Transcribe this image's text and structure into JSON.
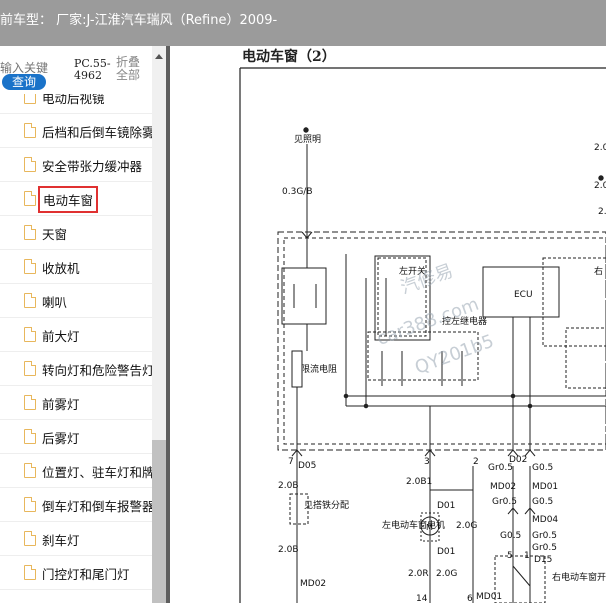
{
  "window": {
    "title": "前车型：   厂家:J-江淮汽车瑞风（Refine）2009-"
  },
  "sidebar": {
    "search_placeholder": "输入关键",
    "search_button": "查询",
    "pc_code": "PC.55-4962",
    "collapse": "折叠全部",
    "items": [
      {
        "label": "电动后视镜"
      },
      {
        "label": "后档和后倒车镜除雾"
      },
      {
        "label": "安全带张力缓冲器"
      },
      {
        "label": "电动车窗",
        "selected": true
      },
      {
        "label": "天窗"
      },
      {
        "label": "收放机"
      },
      {
        "label": "喇叭"
      },
      {
        "label": "前大灯"
      },
      {
        "label": "转向灯和危险警告灯"
      },
      {
        "label": "前雾灯"
      },
      {
        "label": "后雾灯"
      },
      {
        "label": "位置灯、驻车灯和牌"
      },
      {
        "label": "倒车灯和倒车报警器"
      },
      {
        "label": "刹车灯"
      },
      {
        "label": "门控灯和尾门灯"
      }
    ]
  },
  "document": {
    "title": "电动车窗（2）",
    "watermark": [
      "汽修易",
      "car388.com",
      "QY201b5"
    ],
    "diagram": {
      "labels": {
        "headlight": "见照明",
        "wire_03gb": "0.3G/B",
        "limit_resistor": "限流电阻",
        "left_switch": "左开关",
        "left_relay": "控左继电器",
        "ecu": "ECU",
        "right_sw_partial": "右",
        "gnd_left": "见搭铁分配",
        "left_motor": "左电动车窗电机",
        "right_switch": "右电动车窗开",
        "d05": "D05",
        "d02": "D02",
        "d01a": "D01",
        "d01b": "D01",
        "d15": "D15",
        "md02a": "MD02",
        "md01": "MD01",
        "md04": "MD04",
        "md02b": "MD02",
        "md01b": "MD01",
        "w20b_a": "2.0B",
        "w20b_b": "2.0B",
        "w20b1": "2.0B1",
        "w20g": "2.0G",
        "w20r": "2.0R",
        "w20g1": "2.0G",
        "gr05": "Gr0.5",
        "g05": "G0.5",
        "gr05b": "Gr0.5",
        "g05b": "G0.5",
        "gb05": "Gr0.5",
        "g05c": "G0.5",
        "gr05c": "Gr0.5",
        "pin7": "7",
        "pin3": "3",
        "pin2": "2",
        "pin5": "5",
        "pin1": "1",
        "pin14": "14",
        "pin6": "6",
        "m": "M",
        "edge1": "2.0",
        "edge2": "2.0",
        "edge3": "2."
      }
    }
  }
}
